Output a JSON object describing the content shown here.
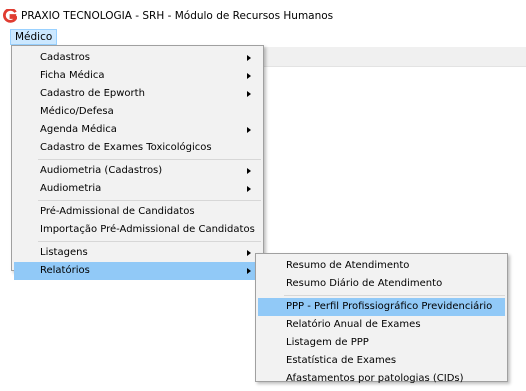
{
  "window": {
    "title": "PRAXIO TECNOLOGIA - SRH - Módulo de Recursos Humanos",
    "icon": "praxio-logo-icon",
    "icon_color": "#e03c31"
  },
  "menubar": {
    "active": "Médico"
  },
  "main_menu": [
    {
      "label": "Cadastros",
      "submenu": true
    },
    {
      "label": "Ficha Médica",
      "submenu": true
    },
    {
      "label": "Cadastro de Epworth",
      "submenu": true
    },
    {
      "label": "Médico/Defesa",
      "submenu": false
    },
    {
      "label": "Agenda Médica",
      "submenu": true
    },
    {
      "label": "Cadastro de Exames Toxicológicos",
      "submenu": false
    },
    {
      "separator": true
    },
    {
      "label": "Audiometria (Cadastros)",
      "submenu": true
    },
    {
      "label": "Audiometria",
      "submenu": true
    },
    {
      "separator": true
    },
    {
      "label": "Pré-Admissional de Candidatos",
      "submenu": false
    },
    {
      "label": "Importação Pré-Admissional de Candidatos",
      "submenu": false
    },
    {
      "separator": true
    },
    {
      "label": "Listagens",
      "submenu": true
    },
    {
      "label": "Relatórios",
      "submenu": true,
      "highlighted": true
    }
  ],
  "relatorios_submenu": [
    {
      "label": "Resumo de Atendimento"
    },
    {
      "label": "Resumo Diário de Atendimento"
    },
    {
      "separator": true
    },
    {
      "label": "PPP - Perfil Profissiográfico Previdenciário",
      "highlighted": true
    },
    {
      "label": "Relatório Anual de Exames"
    },
    {
      "label": "Listagem de PPP"
    },
    {
      "label": "Estatística de Exames"
    },
    {
      "label": "Afastamentos por patologias (CIDs)"
    }
  ],
  "colors": {
    "highlight": "#91c9f7",
    "menubar_active": "#cce8ff",
    "menu_bg": "#f2f2f2"
  }
}
